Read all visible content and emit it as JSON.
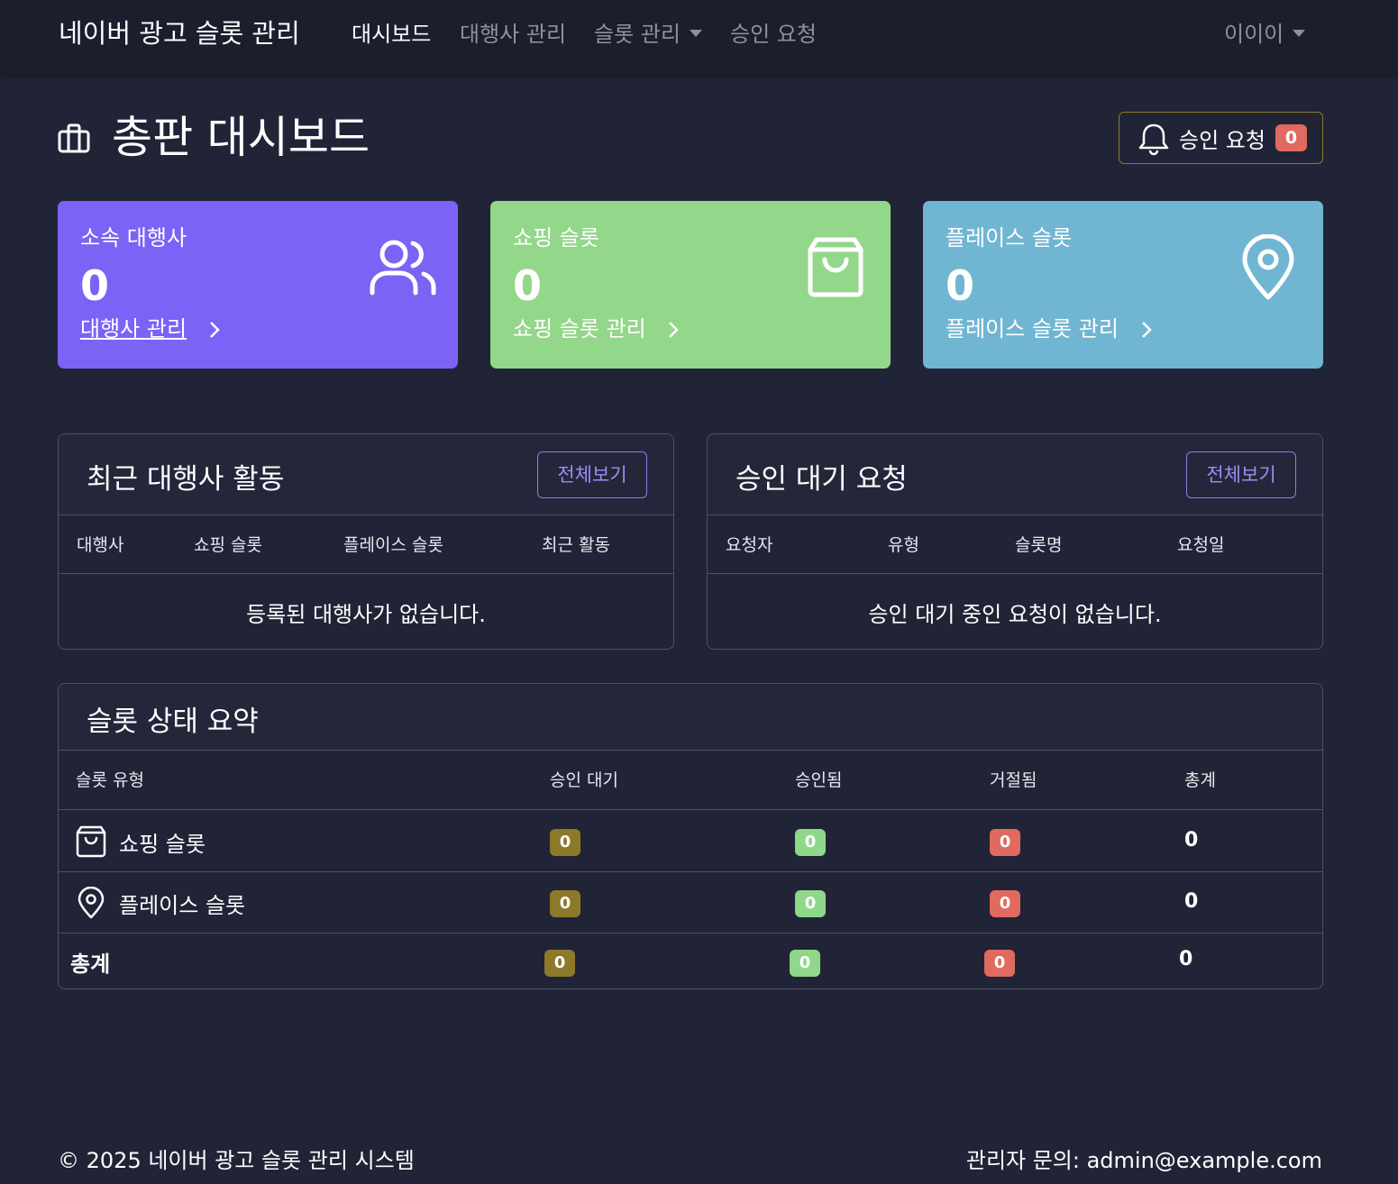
{
  "navbar": {
    "brand": "네이버 광고 슬롯 관리",
    "links": [
      {
        "label": "대시보드"
      },
      {
        "label": "대행사 관리"
      },
      {
        "label": "슬롯 관리"
      },
      {
        "label": "승인 요청"
      }
    ],
    "user": "이이이"
  },
  "page": {
    "title": "총판 대시보드",
    "approval_button": {
      "label": "승인 요청",
      "count": "0"
    }
  },
  "stats": [
    {
      "title": "소속 대행사",
      "value": "0",
      "link": "대행사 관리",
      "icon": "users-icon",
      "color": "#7b63f5"
    },
    {
      "title": "쇼핑 슬롯",
      "value": "0",
      "link": "쇼핑 슬롯 관리",
      "icon": "shopping-bag-icon",
      "color": "#93d78a"
    },
    {
      "title": "플레이스 슬롯",
      "value": "0",
      "link": "플레이스 슬롯 관리",
      "icon": "map-pin-icon",
      "color": "#70b6d2"
    }
  ],
  "recent_activity": {
    "title": "최근 대행사 활동",
    "view_all": "전체보기",
    "columns": [
      "대행사",
      "쇼핑 슬롯",
      "플레이스 슬롯",
      "최근 활동"
    ],
    "empty": "등록된 대행사가 없습니다."
  },
  "pending_requests": {
    "title": "승인 대기 요청",
    "view_all": "전체보기",
    "columns": [
      "요청자",
      "유형",
      "슬롯명",
      "요청일"
    ],
    "empty": "승인 대기 중인 요청이 없습니다."
  },
  "slot_summary": {
    "title": "슬롯 상태 요약",
    "columns": [
      "슬롯 유형",
      "승인 대기",
      "승인됨",
      "거절됨",
      "총계"
    ],
    "rows": [
      {
        "type": "쇼핑 슬롯",
        "icon": "shopping-bag-icon",
        "pending": "0",
        "approved": "0",
        "rejected": "0",
        "total": "0"
      },
      {
        "type": "플레이스 슬롯",
        "icon": "map-pin-icon",
        "pending": "0",
        "approved": "0",
        "rejected": "0",
        "total": "0"
      }
    ],
    "total_row": {
      "label": "총계",
      "pending": "0",
      "approved": "0",
      "rejected": "0",
      "total": "0"
    }
  },
  "footer": {
    "left": "© 2025 네이버 광고 슬롯 관리 시스템",
    "right": "관리자 문의: admin@example.com"
  },
  "colors": {
    "pending": "#8c7a2a",
    "approved": "#8fd88a",
    "rejected": "#e06a5f"
  }
}
